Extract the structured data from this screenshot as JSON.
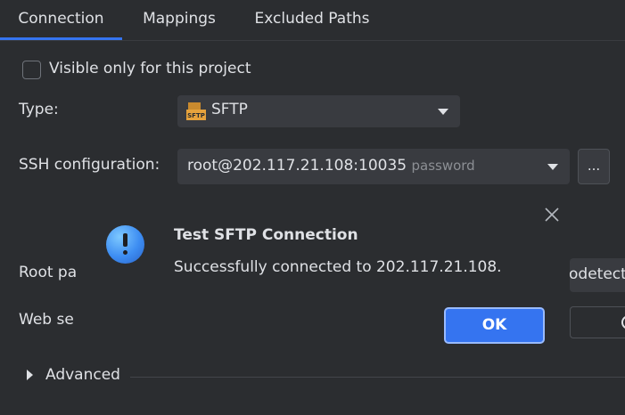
{
  "tabs": [
    {
      "label": "Connection",
      "selected": true
    },
    {
      "label": "Mappings"
    },
    {
      "label": "Excluded Paths"
    }
  ],
  "visible_only": {
    "label": "Visible only for this project",
    "checked": false
  },
  "type": {
    "label": "Type:",
    "value": "SFTP",
    "icon": "sftp-icon"
  },
  "ssh": {
    "label": "SSH configuration:",
    "value": "root@202.117.21.108:10035",
    "auth": "password",
    "more_button": "..."
  },
  "root_path": {
    "label_visible": "Root pa",
    "value_visible": "odetect"
  },
  "web_server": {
    "label_visible": "Web se"
  },
  "advanced": {
    "label": "Advanced"
  },
  "dialog": {
    "title": "Test SFTP Connection",
    "message": "Successfully connected to 202.117.21.108.",
    "ok_label": "OK",
    "icon": "info-icon"
  },
  "colors": {
    "background": "#2b2d30",
    "accent": "#3574f0",
    "field": "#393b40",
    "text": "#dfe1e5",
    "muted": "#8c8f94"
  }
}
